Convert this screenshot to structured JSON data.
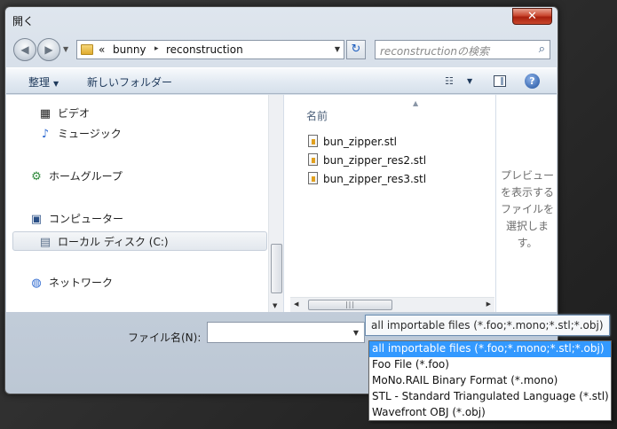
{
  "window": {
    "title": "開く",
    "close_glyph": "✕"
  },
  "nav": {
    "back_glyph": "◀",
    "forward_glyph": "▶",
    "dropdown_glyph": "▼"
  },
  "address": {
    "overflow": "«",
    "separator": "▸",
    "crumbs": [
      "bunny",
      "reconstruction"
    ],
    "dropdown_glyph": "▼",
    "refresh_glyph": "↻"
  },
  "search": {
    "placeholder": "reconstructionの検索",
    "icon": "search-icon",
    "icon_glyph": "⌕"
  },
  "toolbar": {
    "organize_label": "整理",
    "organize_arrow": "▼",
    "new_folder_label": "新しいフォルダー",
    "view_glyph": "☷",
    "view_arrow": "▼",
    "help_glyph": "?"
  },
  "sidebar": {
    "items": [
      {
        "label": "ビデオ",
        "icon": "video-icon",
        "glyph": "▦"
      },
      {
        "label": "ミュージック",
        "icon": "music-icon",
        "glyph": "♪"
      },
      {
        "label": "ホームグループ",
        "icon": "homegroup-icon",
        "glyph": "⚙"
      },
      {
        "label": "コンピューター",
        "icon": "computer-icon",
        "glyph": "▣"
      },
      {
        "label": "ローカル ディスク (C:)",
        "icon": "disk-icon",
        "glyph": "▤",
        "selected": true
      },
      {
        "label": "ネットワーク",
        "icon": "network-icon",
        "glyph": "◍"
      }
    ],
    "scroll_down_glyph": "▼"
  },
  "files": {
    "column_header": "名前",
    "sort_glyph": "▲",
    "items": [
      "bun_zipper.stl",
      "bun_zipper_res2.stl",
      "bun_zipper_res3.stl"
    ],
    "hscroll": {
      "left_glyph": "◀",
      "right_glyph": "▶",
      "grip": "|||"
    }
  },
  "preview": {
    "text": "プレビューを表示するファイルを選択します。"
  },
  "filename": {
    "label": "ファイル名(N):",
    "value": "",
    "dropdown_glyph": "▼"
  },
  "filter": {
    "selected": "all importable files (*.foo;*.mono;*.stl;*.obj)",
    "options": [
      "all importable files (*.foo;*.mono;*.stl;*.obj)",
      "Foo File (*.foo)",
      "MoNo.RAIL Binary Format (*.mono)",
      "STL - Standard Triangulated Language (*.stl)",
      "Wavefront OBJ (*.obj)"
    ],
    "highlight_color": "#3399ff"
  }
}
